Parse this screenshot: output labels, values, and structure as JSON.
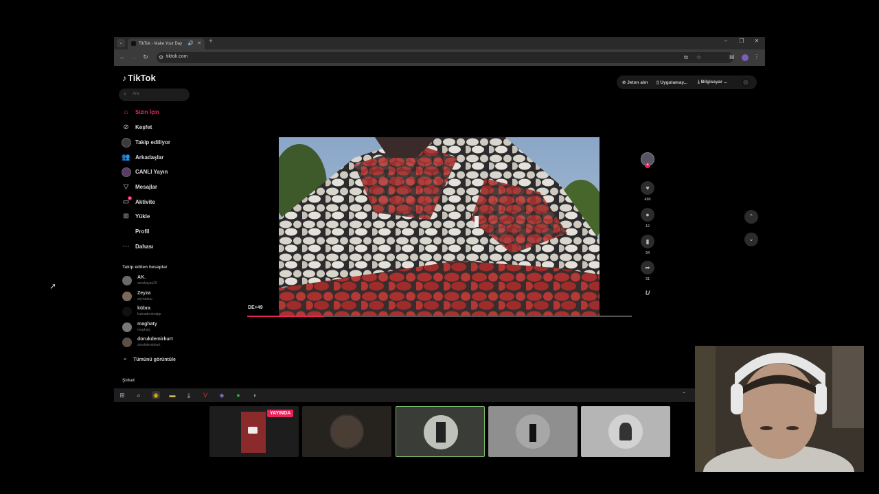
{
  "browser": {
    "tab_title": "TikTok - Make Your Day",
    "new_tab": "+",
    "url": "tiktok.com",
    "win_min": "–",
    "win_max": "❐",
    "win_close": "✕"
  },
  "tiktok": {
    "logo": "TikTok",
    "search_placeholder": "Ara",
    "nav": [
      {
        "label": "Sizin İçin",
        "icon": "home-icon"
      },
      {
        "label": "Keşfet",
        "icon": "compass-icon"
      },
      {
        "label": "Takip ediliyor",
        "icon": "following-avatar"
      },
      {
        "label": "Arkadaşlar",
        "icon": "friends-icon"
      },
      {
        "label": "CANLI Yayın",
        "icon": "live-avatar"
      },
      {
        "label": "Mesajlar",
        "icon": "send-icon"
      },
      {
        "label": "Aktivite",
        "icon": "inbox-icon",
        "badge": "5"
      },
      {
        "label": "Yükle",
        "icon": "upload-icon"
      },
      {
        "label": "Profil",
        "icon": "profile-icon"
      },
      {
        "label": "Dahası",
        "icon": "more-icon"
      }
    ],
    "following_title": "Takip edilen hesaplar",
    "following": [
      {
        "name": "AK.",
        "handle": "azrakayaa29"
      },
      {
        "name": "Zeyza",
        "handle": "zeynaduu"
      },
      {
        "name": "kübra",
        "handle": "kubrademiralpp"
      },
      {
        "name": "maghaty",
        "handle": "maghaty"
      },
      {
        "name": "dorukdemirkurt",
        "handle": "dorukdemirkurt"
      }
    ],
    "see_all": "Tümünü görüntüle",
    "company": "Şirket",
    "topbar": {
      "coins": "Jeton alın",
      "app": "Uygulamay...",
      "computer": "Bilgisayar ..."
    },
    "video": {
      "timecode": "DE+49",
      "progress": 0.2
    },
    "actions": {
      "likes": "490",
      "comments": "12",
      "saves": "34",
      "shares": "31"
    }
  },
  "stream": {
    "live_label": "YAYINDA"
  }
}
